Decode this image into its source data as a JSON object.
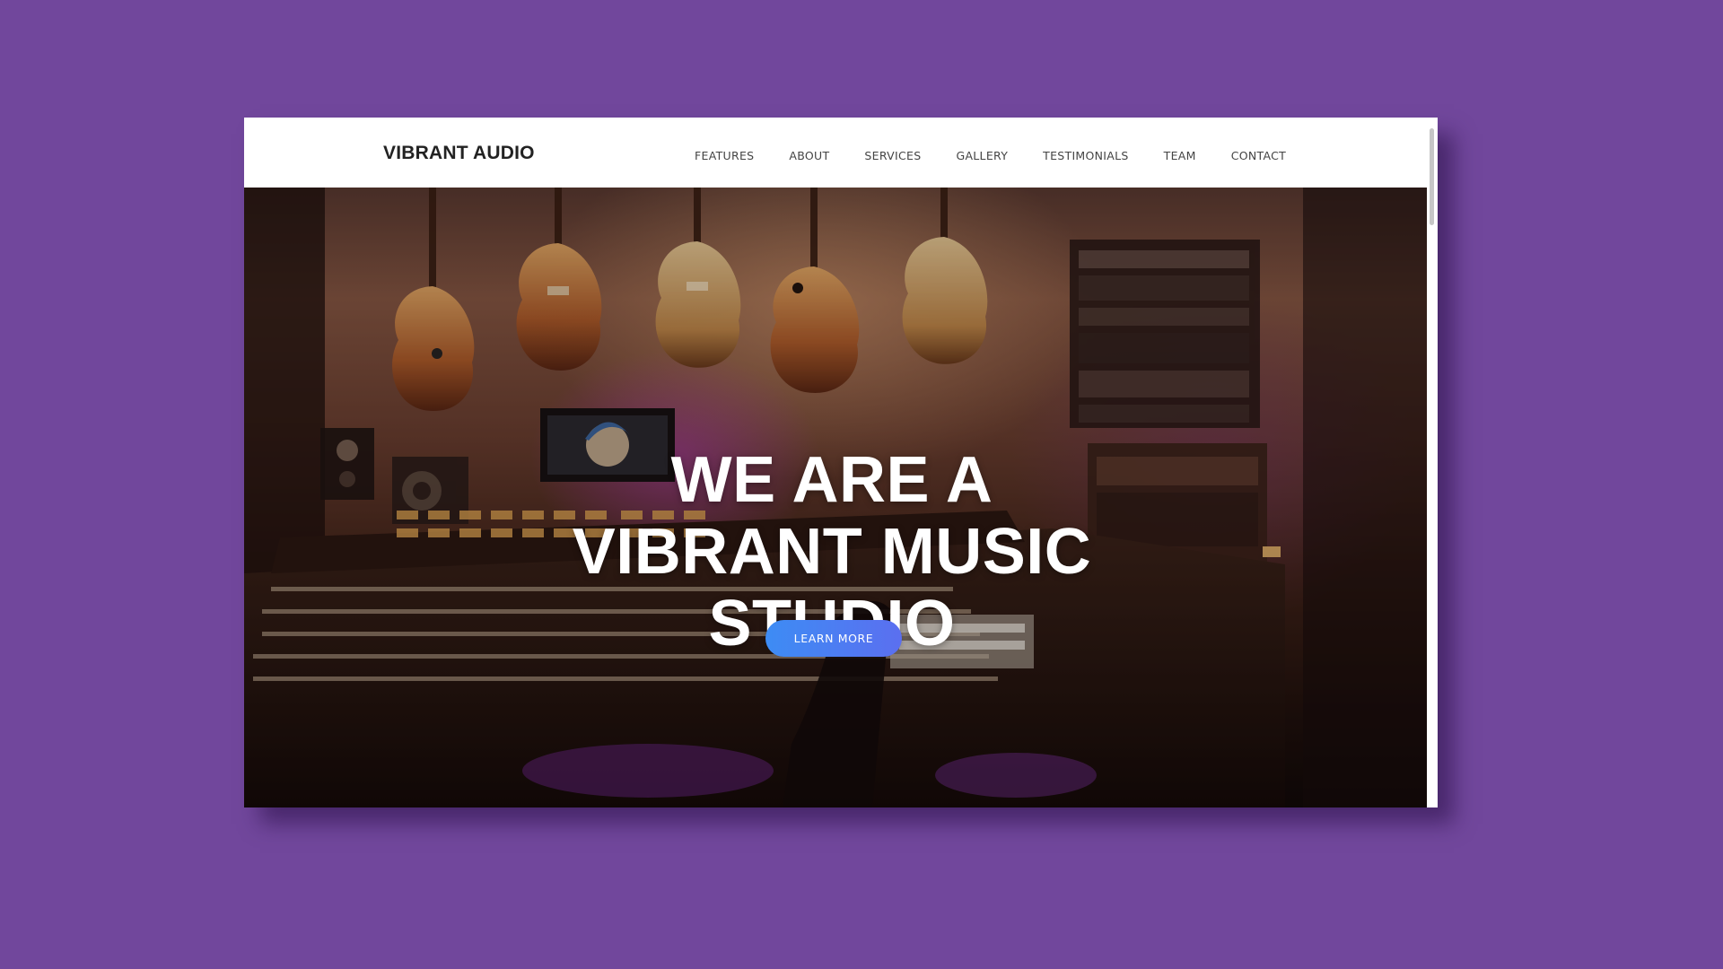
{
  "brand": "VIBRANT AUDIO",
  "nav": {
    "items": [
      "FEATURES",
      "ABOUT",
      "SERVICES",
      "GALLERY",
      "TESTIMONIALS",
      "TEAM",
      "CONTACT"
    ]
  },
  "hero": {
    "headline_lines": [
      "WE ARE A",
      "VIBRANT MUSIC",
      "STUDIO"
    ],
    "cta_label": "LEARN MORE",
    "background_description_icon": "recording-studio-photo"
  },
  "colors": {
    "page_background": "#71479c",
    "cta_start": "#3d8cf4",
    "cta_end": "#5b6ff0",
    "brand_text": "#222222"
  }
}
